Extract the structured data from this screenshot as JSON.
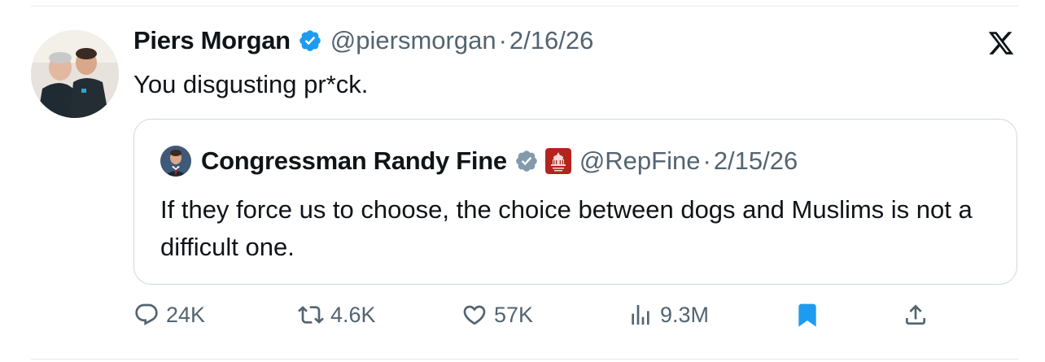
{
  "tweet": {
    "author_name": "Piers Morgan",
    "author_handle": "@piersmorgan",
    "separator": "·",
    "date": "2/16/26",
    "text": "You disgusting pr*ck.",
    "verified_icon": "verified-badge-icon",
    "platform_icon": "x-logo-icon"
  },
  "quote": {
    "author_name": "Congressman Randy Fine",
    "author_handle": "@RepFine",
    "separator": "·",
    "date": "2/15/26",
    "text": "If they force us to choose, the choice between dogs and Muslims is not a difficult one.",
    "verified_icon": "gray-verified-badge-icon",
    "affiliation_icon": "house-gop-badge-icon"
  },
  "actions": {
    "replies": "24K",
    "reposts": "4.6K",
    "likes": "57K",
    "views": "9.3M",
    "bookmarked": true
  },
  "colors": {
    "text": "#0f1419",
    "secondary": "#536471",
    "verified_blue": "#1d9bf0",
    "verified_gray": "#829aab",
    "bookmark_blue": "#1d9bf0",
    "border": "#cfd9de"
  }
}
